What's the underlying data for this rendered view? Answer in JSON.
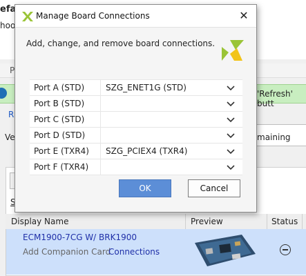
{
  "background": {
    "title_fragment": "efa",
    "subtitle_fragment": "hoo",
    "toolbar_fragment": "P",
    "banner_text": "'Refresh' butt",
    "link_fragment": "R",
    "ve_fragment": "Ve",
    "remaining_fragment": "maining",
    "s_fragment": "S",
    "table": {
      "columns": [
        "Display Name",
        "Preview",
        "Status"
      ],
      "row": {
        "name": "ECM1900-7CG W/ BRK1900",
        "companion_label": "Add Companion Card",
        "connections_link": "Connections"
      }
    }
  },
  "dialog": {
    "title": "Manage Board Connections",
    "close_glyph": "✕",
    "description": "Add, change, and remove board connections.",
    "ports": [
      {
        "name": "Port A (STD)",
        "value": "SZG_ENET1G (STD)"
      },
      {
        "name": "Port B (STD)",
        "value": ""
      },
      {
        "name": "Port C (STD)",
        "value": ""
      },
      {
        "name": "Port D (STD)",
        "value": ""
      },
      {
        "name": "Port E (TXR4)",
        "value": "SZG_PCIEX4 (TXR4)"
      },
      {
        "name": "Port F (TXR4)",
        "value": ""
      }
    ],
    "ok_label": "OK",
    "cancel_label": "Cancel"
  },
  "colors": {
    "accent": "#5c8ed7",
    "selection": "#cde0fb",
    "banner": "#c8eec0",
    "logo_green": "#9ac437",
    "logo_yellow": "#f2c418"
  },
  "icons": [
    "app-logo-icon",
    "close-icon",
    "vendor-logo-icon",
    "chevron-down-icon",
    "info-icon",
    "remove-circle-icon"
  ]
}
